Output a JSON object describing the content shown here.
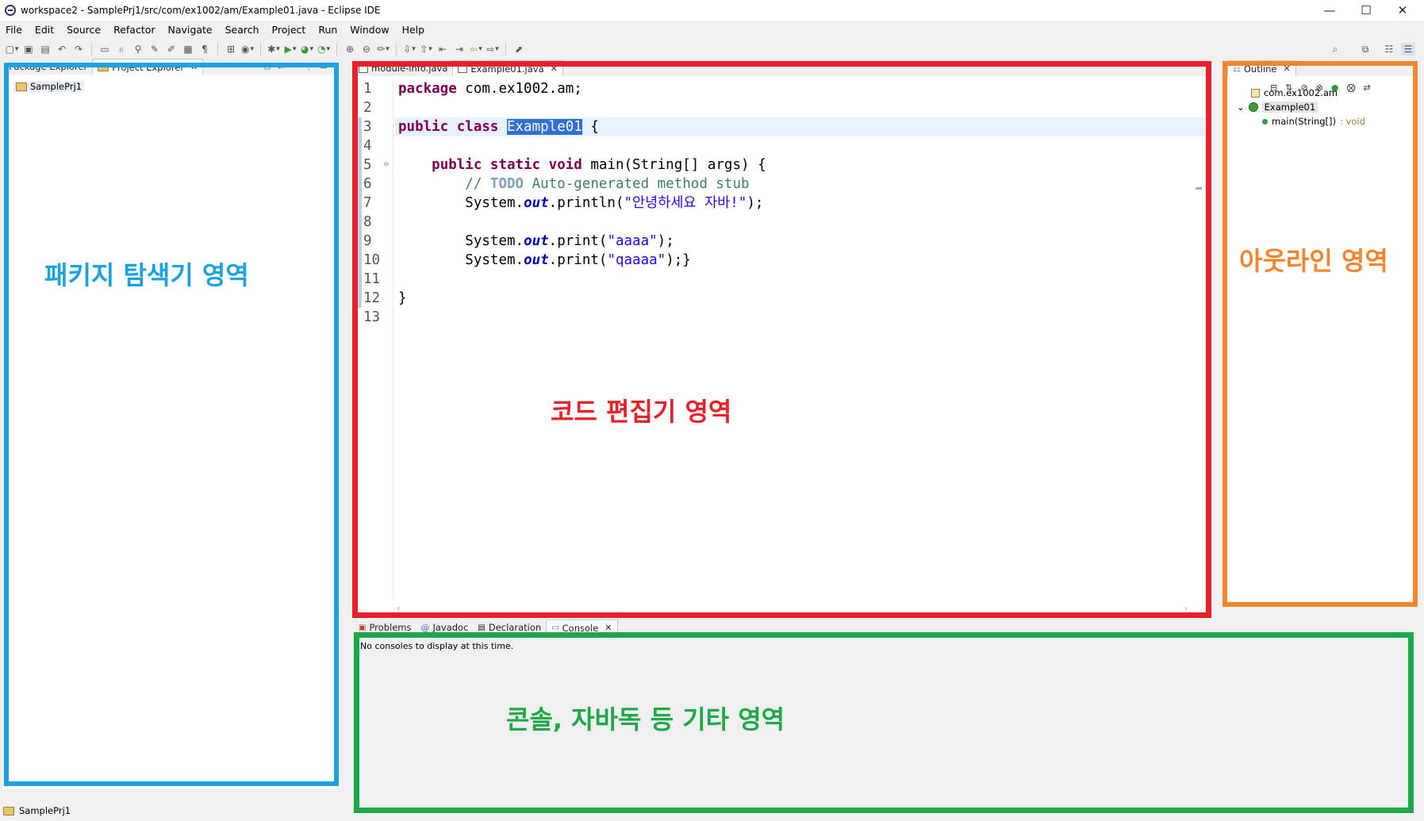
{
  "window": {
    "title": "workspace2 - SamplePrj1/src/com/ex1002/am/Example01.java - Eclipse IDE",
    "controls": [
      "—",
      "☐",
      "✕"
    ]
  },
  "menu": [
    "File",
    "Edit",
    "Source",
    "Refactor",
    "Navigate",
    "Search",
    "Project",
    "Run",
    "Window",
    "Help"
  ],
  "explorer": {
    "tabs": [
      {
        "label": "Package Explorer"
      },
      {
        "label": "Project Explorer"
      }
    ],
    "tree": [
      {
        "label": "SamplePrj1"
      }
    ]
  },
  "editor": {
    "tabs": [
      {
        "label": "module-info.java"
      },
      {
        "label": "Example01.java"
      }
    ],
    "line_numbers": [
      "1",
      "2",
      "3",
      "4",
      "5",
      "6",
      "7",
      "8",
      "9",
      "10",
      "11",
      "12",
      "13"
    ],
    "code": {
      "l1_kw": "package",
      "l1_rest": " com.ex1002.am;",
      "l3_kw": "public class",
      "l3_sel": "Example01",
      "l3_rest": " {",
      "l5_kw": "public static void",
      "l5_rest": " main(String[] args) {",
      "l6_cm": "// ",
      "l6_todo": "TODO",
      "l6_rest": " Auto-generated method stub",
      "l7_a": "System.",
      "l7_f": "out",
      "l7_b": ".println(",
      "l7_s": "\"안녕하세요 자바!\"",
      "l7_c": ");",
      "l9_a": "System.",
      "l9_f": "out",
      "l9_b": ".print(",
      "l9_s": "\"aaaa\"",
      "l9_c": ");",
      "l10_a": "System.",
      "l10_f": "out",
      "l10_b": ".print(",
      "l10_s": "\"qaaaa\"",
      "l10_c": ");}",
      "l12": "}"
    }
  },
  "outline": {
    "tab": "Outline",
    "package": "com.ex1002.am",
    "class": "Example01",
    "method": "main(String[])",
    "method_type": " : void"
  },
  "bottom": {
    "tabs": [
      {
        "label": "Problems"
      },
      {
        "label": "Javadoc"
      },
      {
        "label": "Declaration"
      },
      {
        "label": "Console"
      }
    ],
    "message": "No consoles to display at this time."
  },
  "status": {
    "project": "SamplePrj1"
  },
  "annotations": {
    "explorer": {
      "text": "패키지 탐색기 영역",
      "color": "#1aa3e0"
    },
    "editor": {
      "text": "코드 편집기 영역",
      "color": "#e8202a"
    },
    "outline": {
      "text": "아웃라인 영역",
      "color": "#f5842a"
    },
    "console": {
      "text": "콘솔, 자바독 등 기타 영역",
      "color": "#1fa84a"
    }
  }
}
